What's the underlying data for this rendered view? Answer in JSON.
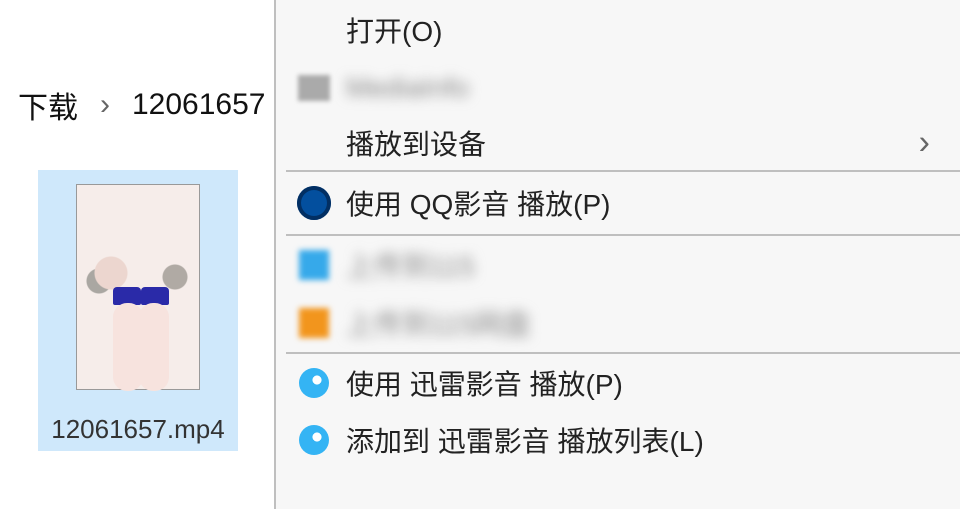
{
  "breadcrumb": {
    "folder": "下载",
    "current": "12061657"
  },
  "file": {
    "name": "12061657.mp4"
  },
  "menu": {
    "open": "打开(O)",
    "mediaInfo": "MediaInfo",
    "castTo": "播放到设备",
    "qqPlay": "使用 QQ影音 播放(P)",
    "upload1": "上传到115",
    "upload2": "上传到115网盘",
    "xunleiPlay": "使用 迅雷影音 播放(P)",
    "xunleiAddList": "添加到 迅雷影音 播放列表(L)"
  }
}
